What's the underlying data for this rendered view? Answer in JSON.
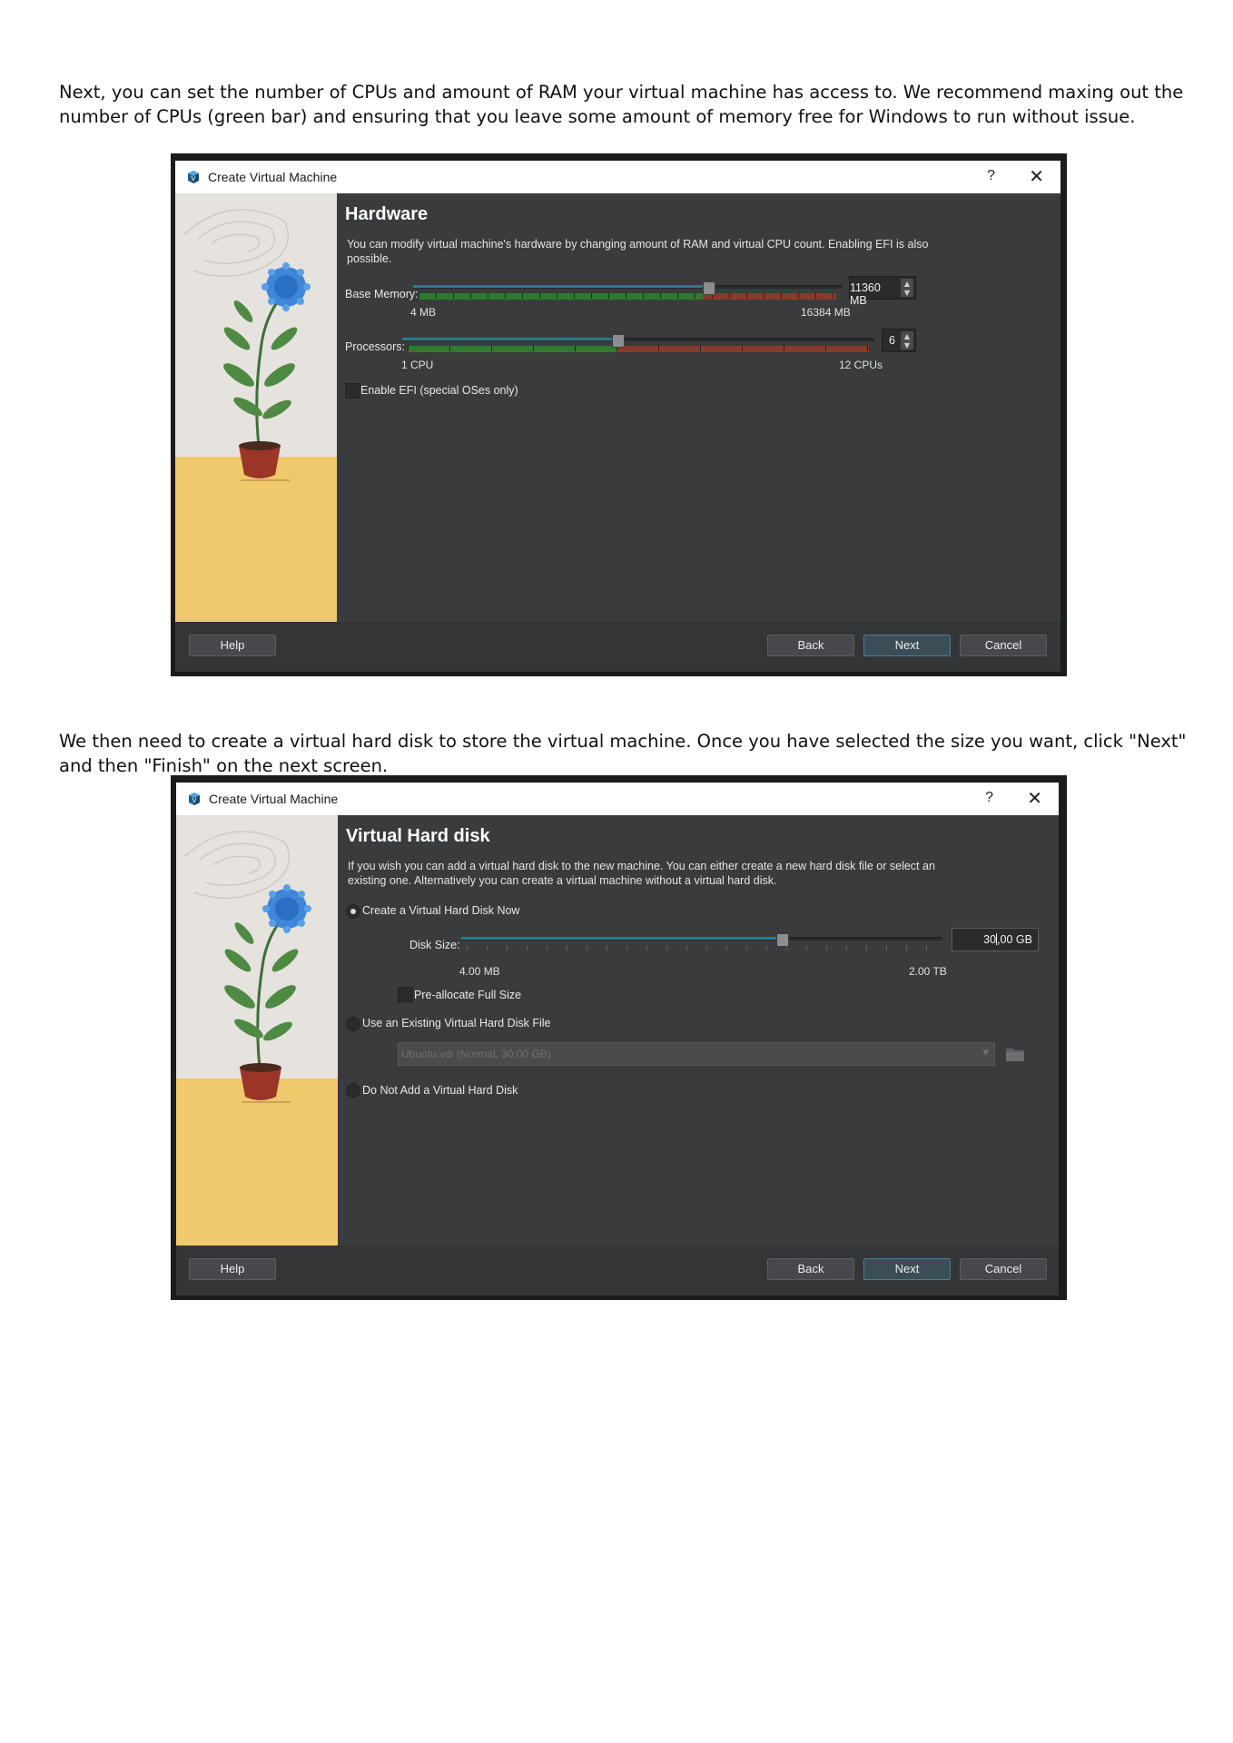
{
  "paragraphs": {
    "p1": "Next, you can set the number of CPUs and amount of RAM your virtual machine has access to. We recommend maxing out the number of CPUs (green bar) and ensuring that you leave some amount of memory free for Windows to run without issue.",
    "p2": "We then need to create a virtual hard disk to store the virtual machine. Once you have selected the size you want, click \"Next\" and then \"Finish\" on the next screen."
  },
  "dialog1": {
    "title": "Create Virtual Machine",
    "help_glyph": "?",
    "close_glyph": "✕",
    "heading": "Hardware",
    "description": "You can modify virtual machine's hardware by changing amount of RAM and virtual CPU count. Enabling EFI is also possible.",
    "memory": {
      "label": "Base Memory:",
      "value": "11360 MB",
      "min_label": "4 MB",
      "max_label": "16384 MB",
      "fraction": 0.693,
      "green_fraction": 0.68
    },
    "processors": {
      "label": "Processors:",
      "value": "6",
      "min_label": "1 CPU",
      "max_label": "12 CPUs",
      "fraction": 0.455,
      "green_fraction": 0.455
    },
    "efi_label": "Enable EFI (special OSes only)",
    "buttons": {
      "help": "Help",
      "back": "Back",
      "next": "Next",
      "cancel": "Cancel"
    }
  },
  "dialog2": {
    "title": "Create Virtual Machine",
    "help_glyph": "?",
    "close_glyph": "✕",
    "heading": "Virtual Hard disk",
    "description": "If you wish you can add a virtual hard disk to the new machine. You can either create a new hard disk file or select an existing one. Alternatively you can create a virtual machine without a virtual hard disk.",
    "create_now_label": "Create a Virtual Hard Disk Now",
    "disk_size": {
      "label": "Disk Size:",
      "value_before_cursor": "30",
      "value_after_cursor": ",00 GB",
      "min_label": "4.00 MB",
      "max_label": "2.00 TB",
      "fraction": 0.67
    },
    "preallocate_label": "Pre-allocate Full Size",
    "use_existing_label": "Use an Existing Virtual Hard Disk File",
    "existing_file": "Ubuntu.vdi (Normal, 30.00 GB)",
    "no_disk_label": "Do Not Add a Virtual Hard Disk",
    "buttons": {
      "help": "Help",
      "back": "Back",
      "next": "Next",
      "cancel": "Cancel"
    }
  },
  "colors": {
    "dialog_bg": "#3a3b3d",
    "accent": "#2c7a8c",
    "green_zone": "#2f7a30",
    "red_zone": "#8a3a2a"
  },
  "icons": [
    "virtualbox-logo-icon",
    "help-icon",
    "close-icon",
    "spin-up-icon",
    "spin-down-icon",
    "combo-arrow-icon",
    "folder-icon"
  ]
}
